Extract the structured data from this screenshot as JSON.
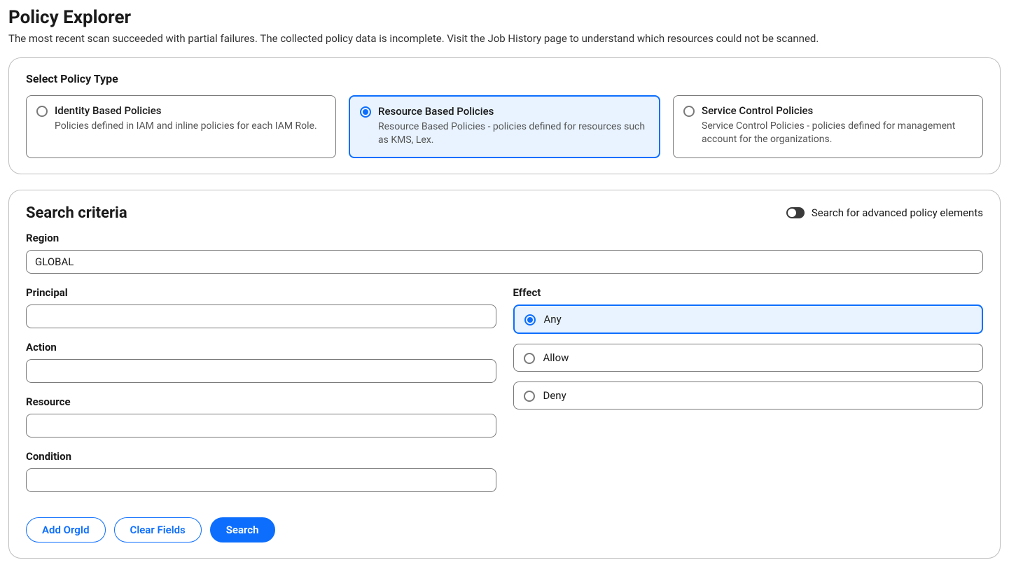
{
  "page": {
    "title": "Policy Explorer",
    "description": "The most recent scan succeeded with partial failures. The collected policy data is incomplete. Visit the Job History page to understand which resources could not be scanned."
  },
  "policy_type_section": {
    "heading": "Select Policy Type",
    "options": [
      {
        "title": "Identity Based Policies",
        "desc": "Policies defined in IAM and inline policies for each IAM Role.",
        "selected": false
      },
      {
        "title": "Resource Based Policies",
        "desc": "Resource Based Policies - policies defined for resources such as KMS, Lex.",
        "selected": true
      },
      {
        "title": "Service Control Policies",
        "desc": "Service Control Policies - policies defined for management account for the organizations.",
        "selected": false
      }
    ]
  },
  "search": {
    "heading": "Search criteria",
    "advanced_toggle_label": "Search for advanced policy elements",
    "advanced_toggle_on": false,
    "fields": {
      "region_label": "Region",
      "region_value": "GLOBAL",
      "principal_label": "Principal",
      "principal_value": "",
      "action_label": "Action",
      "action_value": "",
      "resource_label": "Resource",
      "resource_value": "",
      "condition_label": "Condition",
      "condition_value": ""
    },
    "effect": {
      "label": "Effect",
      "options": [
        {
          "label": "Any",
          "selected": true
        },
        {
          "label": "Allow",
          "selected": false
        },
        {
          "label": "Deny",
          "selected": false
        }
      ]
    },
    "buttons": {
      "add_orgid": "Add OrgId",
      "clear_fields": "Clear Fields",
      "search": "Search"
    }
  }
}
